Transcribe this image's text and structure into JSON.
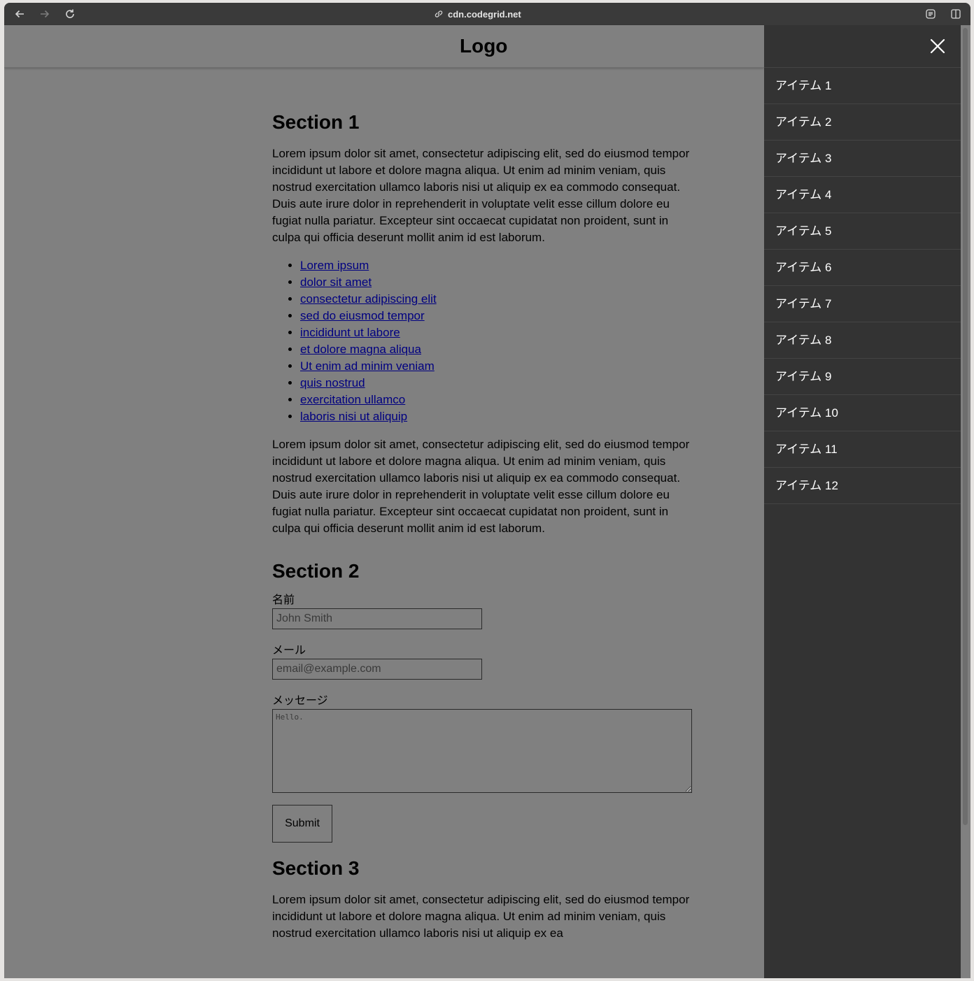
{
  "browser": {
    "url": "cdn.codegrid.net",
    "back_icon": "arrow-left-icon",
    "forward_icon": "arrow-right-icon",
    "reload_icon": "reload-icon"
  },
  "header": {
    "logo": "Logo"
  },
  "sections": {
    "s1": {
      "title": "Section 1",
      "p1": "Lorem ipsum dolor sit amet, consectetur adipiscing elit, sed do eiusmod tempor incididunt ut labore et dolore magna aliqua. Ut enim ad minim veniam, quis nostrud exercitation ullamco laboris nisi ut aliquip ex ea commodo consequat. Duis aute irure dolor in reprehenderit in voluptate velit esse cillum dolore eu fugiat nulla pariatur. Excepteur sint occaecat cupidatat non proident, sunt in culpa qui officia deserunt mollit anim id est laborum.",
      "links": [
        "Lorem ipsum",
        "dolor sit amet",
        "consectetur adipiscing elit",
        "sed do eiusmod tempor",
        "incididunt ut labore",
        "et dolore magna aliqua",
        "Ut enim ad minim veniam",
        "quis nostrud",
        "exercitation ullamco",
        "laboris nisi ut aliquip"
      ],
      "p2": "Lorem ipsum dolor sit amet, consectetur adipiscing elit, sed do eiusmod tempor incididunt ut labore et dolore magna aliqua. Ut enim ad minim veniam, quis nostrud exercitation ullamco laboris nisi ut aliquip ex ea commodo consequat. Duis aute irure dolor in reprehenderit in voluptate velit esse cillum dolore eu fugiat nulla pariatur. Excepteur sint occaecat cupidatat non proident, sunt in culpa qui officia deserunt mollit anim id est laborum."
    },
    "s2": {
      "title": "Section 2",
      "name_label": "名前",
      "name_placeholder": "John Smith",
      "email_label": "メール",
      "email_placeholder": "email@example.com",
      "message_label": "メッセージ",
      "message_placeholder": "Hello.",
      "submit_label": "Submit"
    },
    "s3": {
      "title": "Section 3",
      "p1": "Lorem ipsum dolor sit amet, consectetur adipiscing elit, sed do eiusmod tempor incididunt ut labore et dolore magna aliqua. Ut enim ad minim veniam, quis nostrud exercitation ullamco laboris nisi ut aliquip ex ea"
    }
  },
  "drawer": {
    "close_icon": "close-icon",
    "items": [
      "アイテム 1",
      "アイテム 2",
      "アイテム 3",
      "アイテム 4",
      "アイテム 5",
      "アイテム 6",
      "アイテム 7",
      "アイテム 8",
      "アイテム 9",
      "アイテム 10",
      "アイテム 11",
      "アイテム 12"
    ]
  },
  "colors": {
    "overlay": "#808080",
    "drawer_bg": "#333333",
    "link": "#000080"
  }
}
